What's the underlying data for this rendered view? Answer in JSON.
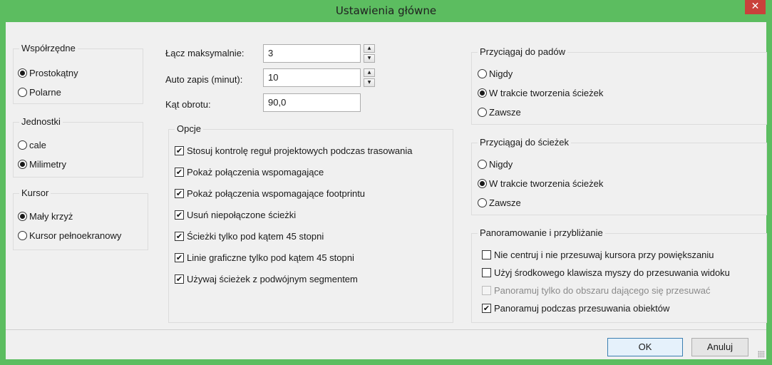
{
  "window": {
    "title": "Ustawienia główne",
    "close_glyph": "✕"
  },
  "coordinates": {
    "label": "Współrzędne",
    "options": [
      {
        "label": "Prostokątny",
        "checked": true
      },
      {
        "label": "Polarne",
        "checked": false
      }
    ]
  },
  "units": {
    "label": "Jednostki",
    "options": [
      {
        "label": "cale",
        "checked": false
      },
      {
        "label": "Milimetry",
        "checked": true
      }
    ]
  },
  "cursor": {
    "label": "Kursor",
    "options": [
      {
        "label": "Mały krzyż",
        "checked": true
      },
      {
        "label": "Kursor pełnoekranowy",
        "checked": false
      }
    ]
  },
  "fields": {
    "max_links": {
      "label": "Łącz maksymalnie:",
      "value": "3"
    },
    "autosave": {
      "label": "Auto zapis (minut):",
      "value": "10"
    },
    "rotation": {
      "label": "Kąt obrotu:",
      "value": "90,0"
    },
    "spin_up": "▲",
    "spin_down": "▼"
  },
  "options": {
    "label": "Opcje",
    "items": [
      {
        "label": "Stosuj kontrolę reguł projektowych podczas trasowania",
        "checked": true
      },
      {
        "label": "Pokaż połączenia wspomagające",
        "checked": true
      },
      {
        "label": "Pokaż połączenia wspomagające footprintu",
        "checked": true
      },
      {
        "label": "Usuń niepołączone ścieżki",
        "checked": true
      },
      {
        "label": "Ścieżki tylko pod kątem 45 stopni",
        "checked": true
      },
      {
        "label": "Linie graficzne tylko pod kątem 45 stopni",
        "checked": true
      },
      {
        "label": "Używaj ścieżek z podwójnym segmentem",
        "checked": true
      }
    ]
  },
  "snap_pads": {
    "label": "Przyciągaj do padów",
    "options": [
      {
        "label": "Nigdy",
        "checked": false
      },
      {
        "label": "W trakcie tworzenia ścieżek",
        "checked": true
      },
      {
        "label": "Zawsze",
        "checked": false
      }
    ]
  },
  "snap_tracks": {
    "label": "Przyciągaj do ścieżek",
    "options": [
      {
        "label": "Nigdy",
        "checked": false
      },
      {
        "label": "W trakcie tworzenia ścieżek",
        "checked": true
      },
      {
        "label": "Zawsze",
        "checked": false
      }
    ]
  },
  "pan_zoom": {
    "label": "Panoramowanie i przybliżanie",
    "items": [
      {
        "label": "Nie centruj i nie przesuwaj kursora przy powiększaniu",
        "checked": false,
        "disabled": false
      },
      {
        "label": "Użyj środkowego klawisza myszy do przesuwania widoku",
        "checked": false,
        "disabled": false
      },
      {
        "label": "Panoramuj tylko do obszaru dającego się przesuwać",
        "checked": false,
        "disabled": true
      },
      {
        "label": "Panoramuj podczas przesuwania obiektów",
        "checked": true,
        "disabled": false
      }
    ]
  },
  "buttons": {
    "ok": "OK",
    "cancel": "Anuluj"
  },
  "check_glyph": "✔",
  "colors": {
    "title_bar": "#5cbd60",
    "close_button": "#c9413b",
    "dialog_bg": "#f0f0f0",
    "default_button_border": "#3c7fb1"
  }
}
